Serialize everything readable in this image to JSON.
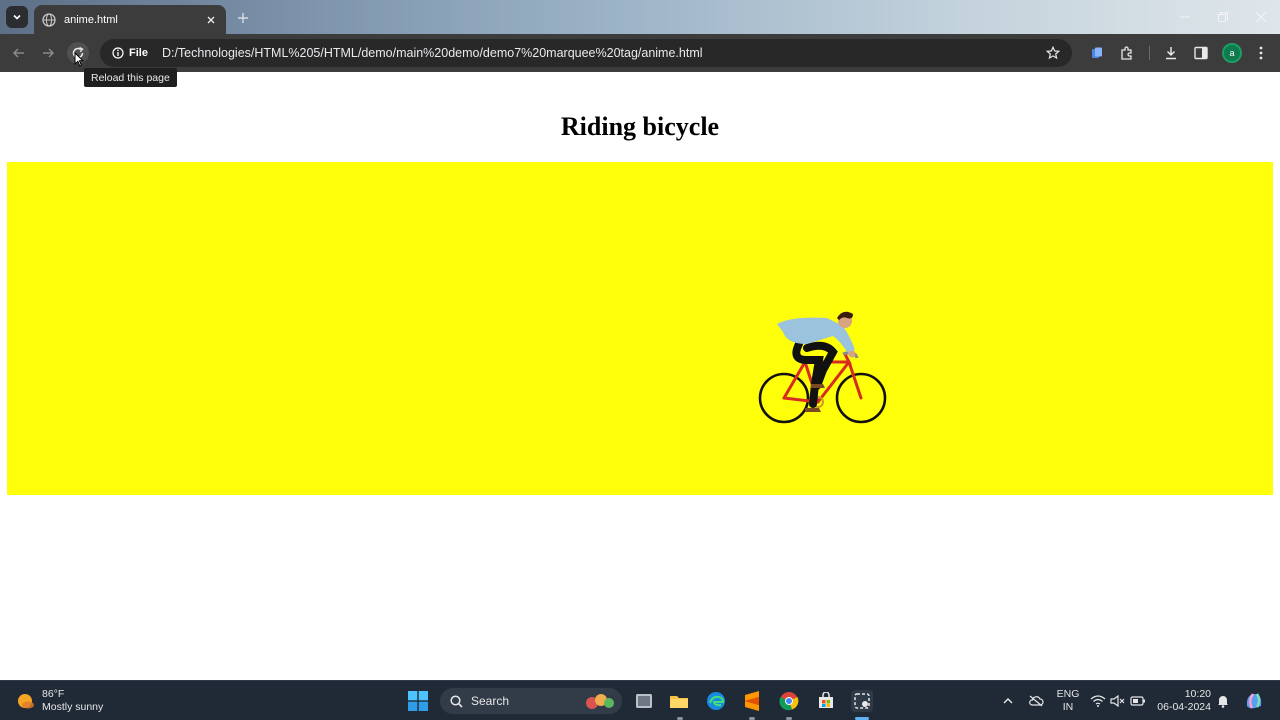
{
  "browser": {
    "tab_title": "anime.html",
    "site_chip_label": "File",
    "url": "D:/Technologies/HTML%205/HTML/demo/main%20demo/demo7%20marquee%20tag/anime.html",
    "tooltip": "Reload this page",
    "profile_initial": "a",
    "accent": "#3c3c3c"
  },
  "page": {
    "heading": "Riding bicycle",
    "marquee_background": "#ffff0a",
    "marquee_image": "cyclist-riding-bicycle"
  },
  "taskbar": {
    "weather_temp": "86°F",
    "weather_condition": "Mostly sunny",
    "search_label": "Search",
    "apps": [
      "widgets",
      "task-view",
      "file-explorer",
      "edge",
      "sublime-text",
      "chrome",
      "store",
      "snipping-tool"
    ],
    "lang_line1": "ENG",
    "lang_line2": "IN",
    "time": "10:20",
    "date": "06-04-2024"
  }
}
